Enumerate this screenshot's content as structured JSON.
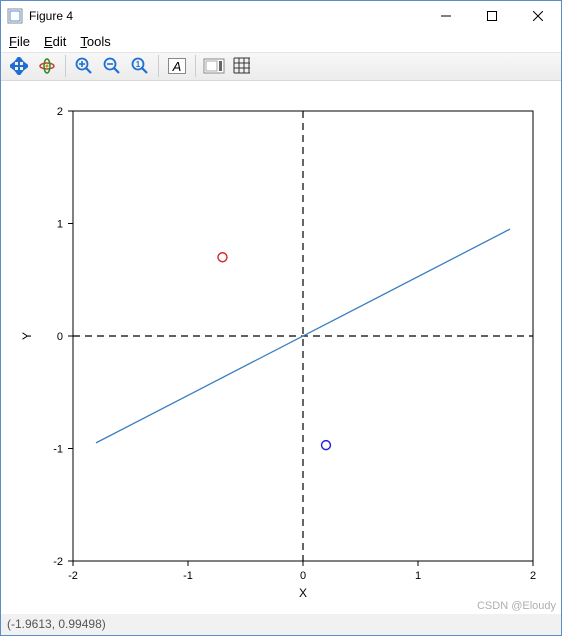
{
  "window": {
    "title": "Figure 4",
    "minimize_icon": "minimize",
    "maximize_icon": "maximize",
    "close_icon": "close"
  },
  "menu": {
    "file": "File",
    "edit": "Edit",
    "tools": "Tools"
  },
  "toolbar": {
    "pan": "pan-icon",
    "rotate": "rotate3d-icon",
    "zoom_in": "zoom-in-icon",
    "zoom_out": "zoom-out-icon",
    "zoom_reset": "zoom-reset-icon",
    "text": "text-icon",
    "colorbar": "colorbar-icon",
    "grid": "grid-icon"
  },
  "status": {
    "coords": "(-1.9613, 0.99498)"
  },
  "watermark": "CSDN @Eloudy",
  "chart_data": {
    "type": "scatter",
    "title": "",
    "xlabel": "X",
    "ylabel": "Y",
    "xlim": [
      -2,
      2
    ],
    "ylim": [
      -2,
      2
    ],
    "xticks": [
      -2,
      -1,
      0,
      1,
      2
    ],
    "yticks": [
      -2,
      -1,
      0,
      1,
      2
    ],
    "grid": false,
    "series": [
      {
        "name": "line",
        "type": "line",
        "color": "#3a7fbf",
        "x": [
          -1.8,
          1.8
        ],
        "y": [
          -0.95,
          0.95
        ]
      },
      {
        "name": "red-point",
        "type": "scatter",
        "color": "#d62728",
        "x": [
          -0.7
        ],
        "y": [
          0.7
        ],
        "marker": "open-circle"
      },
      {
        "name": "blue-point",
        "type": "scatter",
        "color": "#1f1fd6",
        "x": [
          0.2
        ],
        "y": [
          -0.97
        ],
        "marker": "open-circle"
      }
    ],
    "reference_lines": [
      {
        "axis": "x",
        "value": 0,
        "style": "dashed",
        "color": "#000"
      },
      {
        "axis": "y",
        "value": 0,
        "style": "dashed",
        "color": "#000"
      }
    ]
  }
}
